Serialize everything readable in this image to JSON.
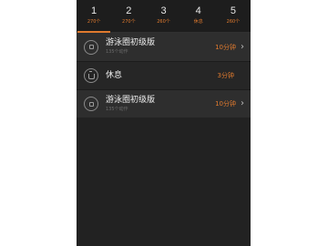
{
  "tabs": [
    {
      "number": "1",
      "sub": "270个"
    },
    {
      "number": "2",
      "sub": "270个"
    },
    {
      "number": "3",
      "sub": "260个"
    },
    {
      "number": "4",
      "sub": "休息"
    },
    {
      "number": "5",
      "sub": "260个"
    }
  ],
  "active_tab": 1,
  "accent_color": "#e07a2e",
  "rows": [
    {
      "icon": "square-circle-icon",
      "title": "游泳圈初级版",
      "subtitle": "135个动作",
      "duration": "10分钟",
      "chevron": "chevron-right-icon"
    },
    {
      "icon": "cup-icon",
      "title": "休息",
      "subtitle": "",
      "duration": "3分钟"
    },
    {
      "icon": "square-circle-icon",
      "title": "游泳圈初级版",
      "subtitle": "135个动作",
      "duration": "10分钟",
      "chevron": "chevron-right-icon"
    }
  ]
}
